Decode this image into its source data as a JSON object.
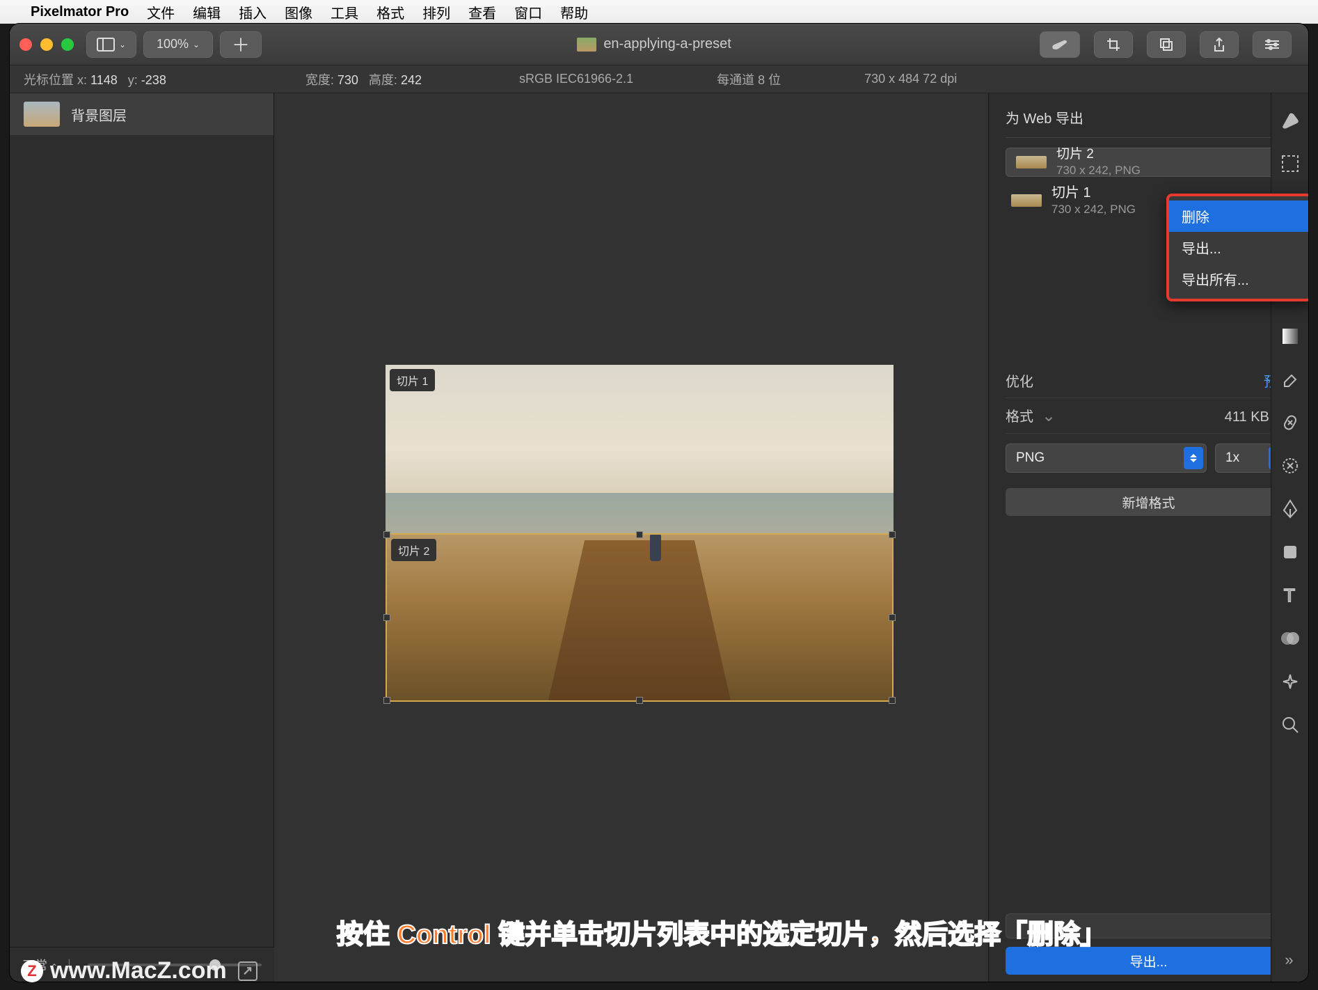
{
  "menubar": {
    "app": "Pixelmator Pro",
    "items": [
      "文件",
      "编辑",
      "插入",
      "图像",
      "工具",
      "格式",
      "排列",
      "查看",
      "窗口",
      "帮助"
    ]
  },
  "titlebar": {
    "zoom": "100%",
    "document": "en-applying-a-preset"
  },
  "infobar": {
    "cursor_label": "光标位置 x:",
    "cursor_x": "1148",
    "cursor_y_label": "y:",
    "cursor_y": "-238",
    "width_label": "宽度:",
    "width": "730",
    "height_label": "高度:",
    "height": "242",
    "colorspace": "sRGB IEC61966-2.1",
    "bitdepth": "每通道 8 位",
    "docsize": "730 x 484 72 dpi"
  },
  "layers": {
    "items": [
      {
        "name": "背景图层"
      }
    ],
    "blend_mode": "正常"
  },
  "canvas": {
    "slices": [
      {
        "label": "切片 1"
      },
      {
        "label": "切片 2"
      }
    ]
  },
  "inspector": {
    "title": "为 Web 导出",
    "slices": [
      {
        "name": "切片 2",
        "sub": "730 x 242, PNG"
      },
      {
        "name": "切片 1",
        "sub": "730 x 242, PNG"
      }
    ],
    "context_menu": {
      "delete": "删除",
      "export": "导出...",
      "export_all": "导出所有..."
    },
    "optimize_label": "优化",
    "preset_link": "预置",
    "format_label": "格式",
    "size_estimate": "411 KB",
    "format_value": "PNG",
    "scale_value": "1x",
    "add_format": "新增格式",
    "export_button": "导出..."
  },
  "caption": "按住 Control 键并单击切片列表中的选定切片，然后选择「删除」",
  "watermark": "www.MacZ.com"
}
